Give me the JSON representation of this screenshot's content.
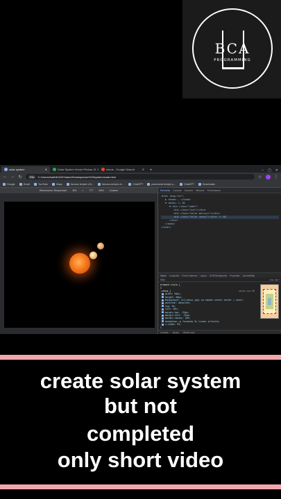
{
  "logo": {
    "title": "BCA",
    "subtitle": "PROGRAMMING"
  },
  "browser": {
    "tabs": [
      {
        "label": "solar system",
        "active": true
      },
      {
        "label": "Solar System Vector Photos, Ill",
        "active": false
      },
      {
        "label": "venus - Google Search",
        "active": false
      }
    ],
    "new_tab": "+",
    "address": {
      "chip": "File",
      "url": "C:/Users/Aadhik%20Yadav/Desktop/solar%20system/solar.html"
    },
    "bookmarks": [
      "Google",
      "Gmail",
      "YouTube",
      "Maps",
      "famous temple of ti...",
      "famous-temple-of-...",
      "ChatGPT",
      "panoramic temple p...",
      "ChatGPT",
      "Downloads"
    ],
    "devbar": {
      "dimensions": "Dimensions: Responsive",
      "width": "303",
      "x": "×",
      "height": "777",
      "zoom": "69%",
      "throttle": "Custom"
    }
  },
  "devtools": {
    "tabs": [
      "Elements",
      "Console",
      "Sources",
      "Network",
      "Performance"
    ],
    "elements_lines": [
      {
        "text": "<html lang=\"en\">",
        "indent": 0,
        "selected": false
      },
      {
        "text": "▶ <head> … </head>",
        "indent": 1,
        "selected": false
      },
      {
        "text": "▼ <body> == $0",
        "indent": 1,
        "selected": false
      },
      {
        "text": "▼ <div class=\"nobe\">",
        "indent": 2,
        "selected": false
      },
      {
        "text": "<div class=\"sun\"></div>",
        "indent": 3,
        "selected": false
      },
      {
        "text": "<div class=\"solar mercury\"></div>",
        "indent": 3,
        "selected": false
      },
      {
        "text": "<div class=\"solar venus\"></div> == $0",
        "indent": 3,
        "selected": true
      },
      {
        "text": "</div>",
        "indent": 2,
        "selected": false
      },
      {
        "text": "</body>",
        "indent": 1,
        "selected": false
      },
      {
        "text": "</html>",
        "indent": 0,
        "selected": false
      }
    ],
    "styles_tabs": [
      "Styles",
      "Computed",
      "Event Listeners",
      "Layout",
      "DOM Breakpoints",
      "Properties",
      "Accessibility"
    ],
    "filter_placeholder": "Filter",
    "filter_flags": ":hov .cls +",
    "rules": [
      "element.style {",
      "}",
      ".venus {",
      "width: 50px;",
      "height: 50px;",
      "background: url(venus.jpg) no-repeat center center / cover;",
      "position: absolute;",
      "top: 0%;",
      "left: 30%;",
      "margin-top: -25px;",
      "margin-left: -25px;",
      "border-radius: 50%;",
      "animation: ▶ forwards 5s linear infinite;",
      "z-index: 99;",
      "}",
      ".solar {",
      "}",
      "div {",
      "display: block;",
      "}"
    ],
    "rule_source": "solar.css:28",
    "ua_label": "user agent stylesheet",
    "console_tabs": [
      "Console",
      "Issues",
      "What's new"
    ]
  },
  "caption": {
    "lines": [
      "create solar system",
      "but not",
      "completed",
      "only short video"
    ]
  },
  "colors": {
    "stripe": "#f2a6ab",
    "sun": "#f6791a",
    "background": "#000000"
  }
}
